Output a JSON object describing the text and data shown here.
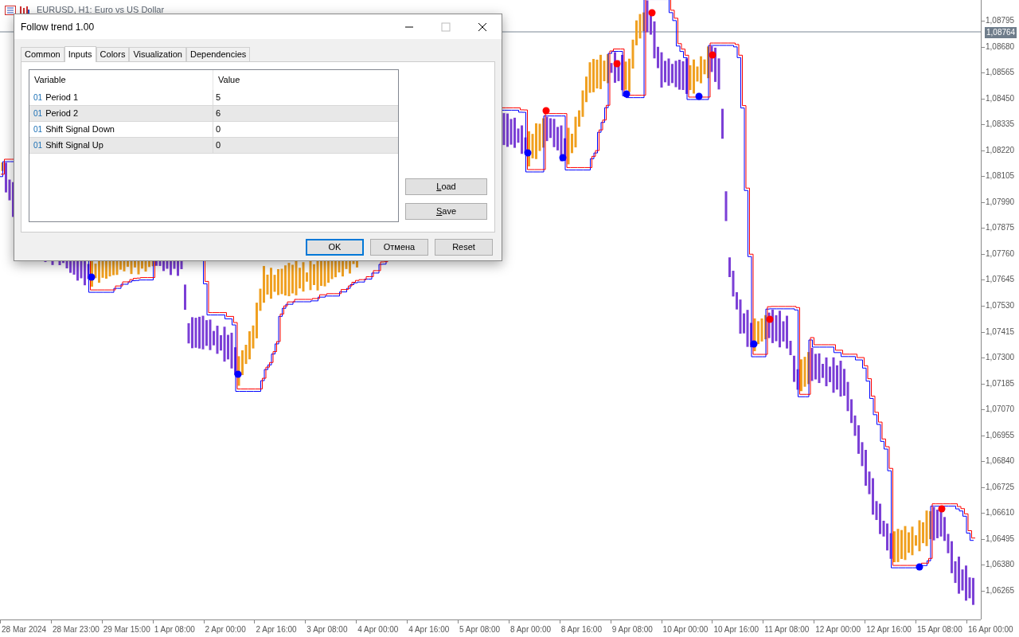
{
  "chart_window": {
    "title": "EURUSD, H1:  Euro vs US Dollar"
  },
  "price_axis": {
    "labels": [
      "1,08795",
      "1,08680",
      "1,08565",
      "1,08450",
      "1,08335",
      "1,08220",
      "1,08105",
      "1,07990",
      "1,07875",
      "1,07760",
      "1,07645",
      "1,07530",
      "1,07415",
      "1,07300",
      "1,07185",
      "1,07070",
      "1,06955",
      "1,06840",
      "1,06725",
      "1,06610",
      "1,06495",
      "1,06380",
      "1,06265"
    ],
    "current_price": "1,08764"
  },
  "time_axis": {
    "labels": [
      "28 Mar 2024",
      "28 Mar 23:00",
      "29 Mar 15:00",
      "1 Apr 08:00",
      "2 Apr 00:00",
      "2 Apr 16:00",
      "3 Apr 08:00",
      "4 Apr 00:00",
      "4 Apr 16:00",
      "5 Apr 08:00",
      "8 Apr 00:00",
      "8 Apr 16:00",
      "9 Apr 08:00",
      "10 Apr 00:00",
      "10 Apr 16:00",
      "11 Apr 08:00",
      "12 Apr 00:00",
      "12 Apr 16:00",
      "15 Apr 08:00",
      "16 Apr 00:00"
    ]
  },
  "dialog": {
    "title": "Follow trend 1.00",
    "tabs": [
      {
        "label": "Common",
        "selected": false
      },
      {
        "label": "Inputs",
        "selected": true
      },
      {
        "label": "Colors",
        "selected": false
      },
      {
        "label": "Visualization",
        "selected": false
      },
      {
        "label": "Dependencies",
        "selected": false
      }
    ],
    "table": {
      "columns": [
        "Variable",
        "Value"
      ],
      "rows": [
        {
          "type_badge": "01",
          "variable": "Period 1",
          "value": "5"
        },
        {
          "type_badge": "01",
          "variable": "Period 2",
          "value": "6"
        },
        {
          "type_badge": "01",
          "variable": "Shift Signal Down",
          "value": "0"
        },
        {
          "type_badge": "01",
          "variable": "Shift Signal Up",
          "value": "0"
        }
      ]
    },
    "side_buttons": [
      "Load",
      "Save"
    ],
    "buttons": [
      {
        "label": "OK",
        "default": true
      },
      {
        "label": "Отмена",
        "default": false
      },
      {
        "label": "Reset",
        "default": false
      }
    ]
  }
}
